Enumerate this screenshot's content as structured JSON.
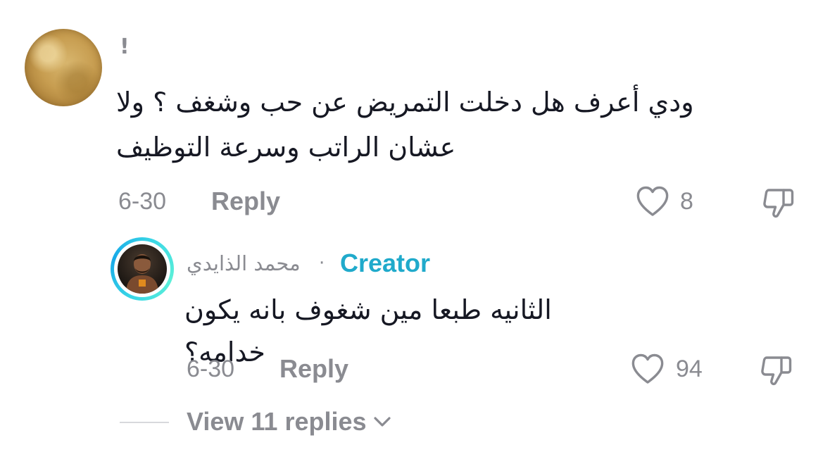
{
  "comment": {
    "username": "!",
    "text": "ودي أعرف هل دخلت التمريض عن حب وشغف ؟ ولا عشان الراتب وسرعة التوظيف",
    "date": "6-30",
    "reply_label": "Reply",
    "like_count": "8",
    "icons": {
      "like": "heart-icon",
      "dislike": "thumbs-down-icon"
    }
  },
  "reply": {
    "username": "محمد الذايدي",
    "separator": "·",
    "badge": "Creator",
    "text": "الثانيه طبعا مين شغوف بانه يكون خدامه؟",
    "date": "6-30",
    "reply_label": "Reply",
    "like_count": "94",
    "icons": {
      "like": "heart-icon",
      "dislike": "thumbs-down-icon"
    }
  },
  "view_replies": {
    "label": "View 11 replies",
    "icon": "chevron-down-icon"
  },
  "colors": {
    "muted": "#8a8b91",
    "text": "#161823",
    "creator": "#20aacb",
    "ring": "#3ad7e6"
  }
}
